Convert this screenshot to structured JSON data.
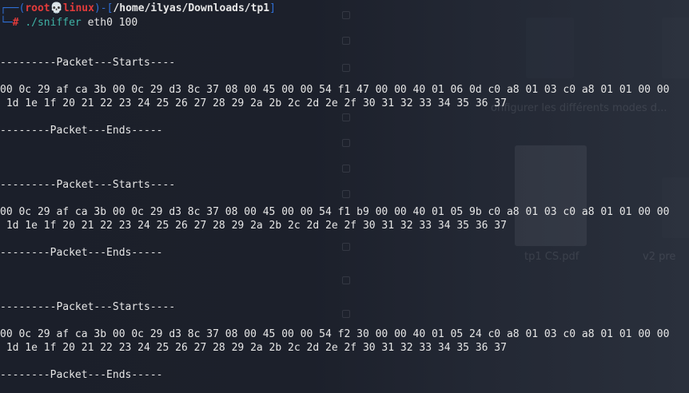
{
  "prompt": {
    "user": "root",
    "skull": "💀",
    "host": "linux",
    "path": "/home/ilyas/Downloads/tp1",
    "symbol": "#",
    "command": "./sniffer",
    "args": "eth0 100"
  },
  "packets": [
    {
      "start": "---------Packet---Starts----",
      "hex1": "00 0c 29 af ca 3b 00 0c 29 d3 8c 37 08 00 45 00 00 54 f1 47 00 00 40 01 06 0d c0 a8 01 03 c0 a8 01 01 00 00",
      "hex2": " 1d 1e 1f 20 21 22 23 24 25 26 27 28 29 2a 2b 2c 2d 2e 2f 30 31 32 33 34 35 36 37",
      "end": "--------Packet---Ends-----"
    },
    {
      "start": "---------Packet---Starts----",
      "hex1": "00 0c 29 af ca 3b 00 0c 29 d3 8c 37 08 00 45 00 00 54 f1 b9 00 00 40 01 05 9b c0 a8 01 03 c0 a8 01 01 00 00",
      "hex2": " 1d 1e 1f 20 21 22 23 24 25 26 27 28 29 2a 2b 2c 2d 2e 2f 30 31 32 33 34 35 36 37",
      "end": "--------Packet---Ends-----"
    },
    {
      "start": "---------Packet---Starts----",
      "hex1": "00 0c 29 af ca 3b 00 0c 29 d3 8c 37 08 00 45 00 00 54 f2 30 00 00 40 01 05 24 c0 a8 01 03 c0 a8 01 01 00 00",
      "hex2": " 1d 1e 1f 20 21 22 23 24 25 26 27 28 29 2a 2b 2c 2d 2e 2f 30 31 32 33 34 35 36 37",
      "end": "--------Packet---Ends-----"
    }
  ],
  "background": {
    "documents": [
      {
        "label": "onfigurer les différents modes d..."
      },
      {
        "label": "tp1 CS.pdf"
      },
      {
        "label": "v2 pre"
      }
    ]
  },
  "colors": {
    "terminal_bg": "#1b1f2a",
    "prompt_bracket": "#2f6fd6",
    "prompt_root": "#e23b3b",
    "command": "#3fb3a6",
    "text": "#e6e6e6"
  }
}
